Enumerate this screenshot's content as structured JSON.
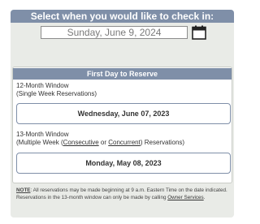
{
  "checkin": {
    "title": "Select when you would like to check in:",
    "date_value": "Sunday, June 9, 2024",
    "calendar_icon": "calendar-icon"
  },
  "reserve": {
    "title": "First Day to Reserve",
    "window12": {
      "label_line1": "12-Month Window",
      "label_line2": "(Single Week Reservations)",
      "date": "Wednesday, June 07, 2023"
    },
    "window13": {
      "label_line1": "13-Month Window",
      "label_prefix": "(Multiple Week (",
      "consecutive_link": "Consecutive",
      "label_or": " or ",
      "concurrent_link": "Concurrent",
      "label_suffix": ") Reservations)",
      "date": "Monday, May 08, 2023"
    }
  },
  "note": {
    "label": "NOTE",
    "text": ": All reservations may be made beginning at 9 a.m. Eastern Time on the date indicated. Reservations in the 13-month window can only be made by calling ",
    "owner_services_link": "Owner Services",
    "end": "."
  },
  "colors": {
    "header_bg": "#7f8fa8",
    "panel_bg": "#e9ebe7"
  }
}
